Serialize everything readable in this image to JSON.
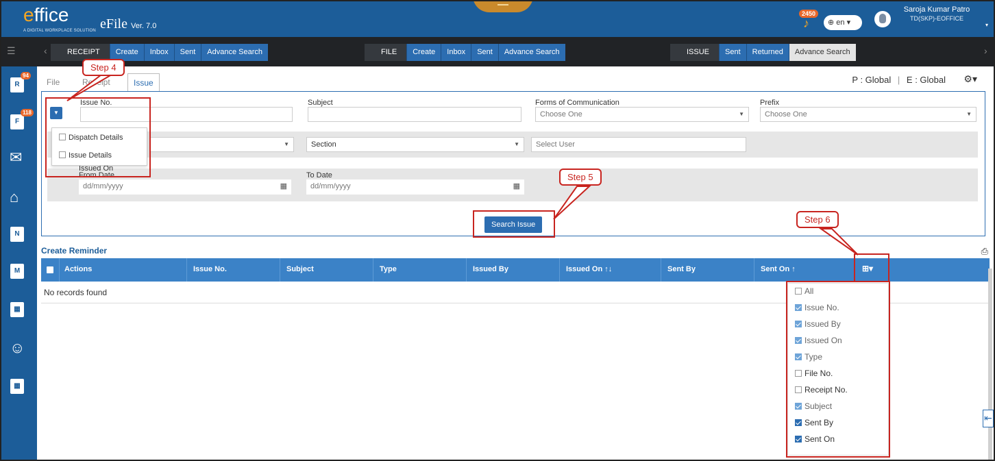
{
  "header": {
    "logo_prefix": "e",
    "logo_rest": "ffice",
    "logo_tagline": "A DIGITAL WORKPLACE SOLUTION",
    "app_name": "eFile",
    "version": "Ver. 7.0",
    "notification_count": "2450",
    "language": "en",
    "user_name": "Saroja Kumar Patro",
    "user_role": "TD(SKP)-EOFFICE"
  },
  "nav": {
    "receipt": {
      "label": "RECEIPT",
      "items": [
        "Create",
        "Inbox",
        "Sent",
        "Advance Search"
      ]
    },
    "file": {
      "label": "FILE",
      "items": [
        "Create",
        "Inbox",
        "Sent",
        "Advance Search"
      ]
    },
    "issue": {
      "label": "ISSUE",
      "items": [
        "Sent",
        "Returned",
        "Advance Search"
      ]
    }
  },
  "sidebar": {
    "items": [
      {
        "icon": "receipt-inbox-icon",
        "badge": "94",
        "glyph": "R"
      },
      {
        "icon": "file-inbox-icon",
        "badge": "118",
        "glyph": "F"
      },
      {
        "icon": "dispatch-mail-icon",
        "glyph": "✉"
      },
      {
        "icon": "home-icon",
        "glyph": "⌂"
      },
      {
        "icon": "new-note-icon",
        "glyph": "N"
      },
      {
        "icon": "migrate-icon",
        "glyph": "M"
      },
      {
        "icon": "docs-icon-1",
        "glyph": "▦"
      },
      {
        "icon": "user-settings-icon",
        "glyph": "☺"
      },
      {
        "icon": "docs-icon-2",
        "glyph": "▦"
      }
    ]
  },
  "tabs": {
    "file": "File",
    "receipt": "Receipt",
    "issue": "Issue"
  },
  "scope": {
    "p": "P : Global",
    "sep": "|",
    "e": "E : Global"
  },
  "form": {
    "issue_no": {
      "label": "Issue No.",
      "value": ""
    },
    "subject": {
      "label": "Subject",
      "value": ""
    },
    "forms_of_communication": {
      "label": "Forms of Communication",
      "value": "Choose One"
    },
    "prefix": {
      "label": "Prefix",
      "value": "Choose One"
    },
    "section": {
      "value": "Section"
    },
    "select_user": {
      "placeholder": "Select User"
    },
    "issued_on_label": "Issued On",
    "from_date": {
      "label": "From Date",
      "placeholder": "dd/mm/yyyy"
    },
    "to_date": {
      "label": "To Date",
      "placeholder": "dd/mm/yyyy"
    },
    "search_button": "Search Issue"
  },
  "filter_menu": {
    "items": [
      {
        "label": "Dispatch Details",
        "checked": false
      },
      {
        "label": "Issue Details",
        "checked": false
      }
    ]
  },
  "grid": {
    "section_title": "Create Reminder",
    "columns": [
      "Actions",
      "Issue No.",
      "Subject",
      "Type",
      "Issued By",
      "Issued On",
      "Sent By",
      "Sent On"
    ],
    "empty_message": "No records found"
  },
  "column_menu": {
    "items": [
      {
        "label": "All",
        "checked": false
      },
      {
        "label": "Issue No.",
        "checked": true
      },
      {
        "label": "Issued By",
        "checked": true
      },
      {
        "label": "Issued On",
        "checked": true
      },
      {
        "label": "Type",
        "checked": true
      },
      {
        "label": "File No.",
        "checked": false
      },
      {
        "label": "Receipt No.",
        "checked": false
      },
      {
        "label": "Subject",
        "checked": true
      },
      {
        "label": "Sent By",
        "checked": true
      },
      {
        "label": "Sent On",
        "checked": true
      }
    ]
  },
  "annotations": {
    "step4": "Step 4",
    "step5": "Step 5",
    "step6": "Step 6"
  },
  "colors": {
    "brand": "#1c5d99",
    "nav_dark": "#212326",
    "accent_blue": "#2c6db1",
    "annotation_red": "#c8241f",
    "badge_orange": "#e8672a"
  }
}
